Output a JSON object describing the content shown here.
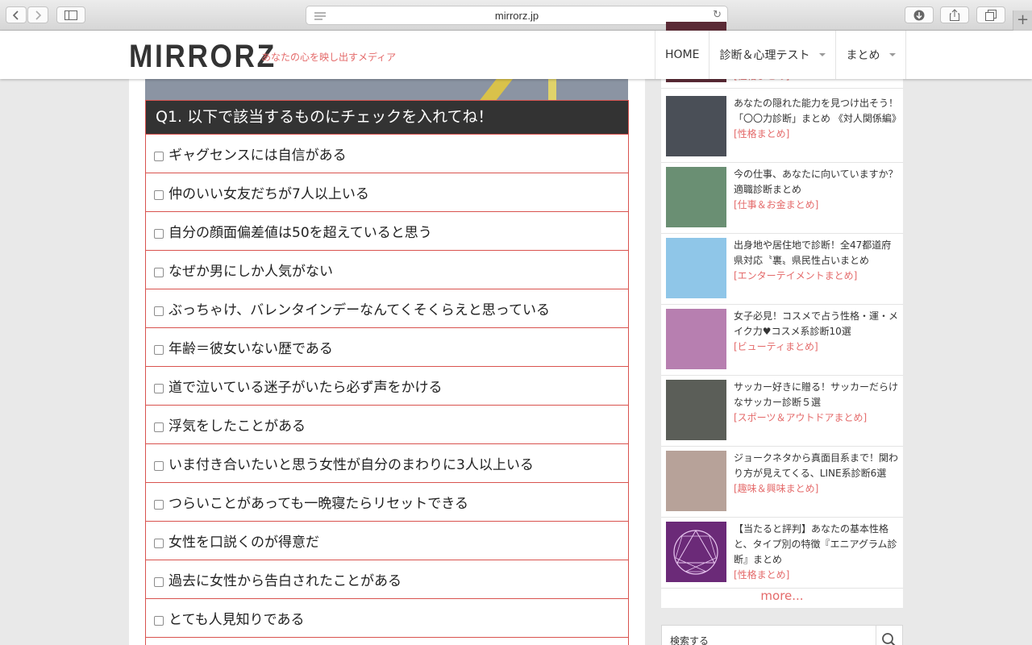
{
  "browser": {
    "url": "mirrorz.jp"
  },
  "site": {
    "logo": "MIRRORZ",
    "tagline": "あなたの心を映し出すメディア",
    "nav": [
      "HOME",
      "診断＆心理テスト",
      "まとめ"
    ]
  },
  "question": {
    "title": "Q1. 以下で該当するものにチェックを入れてね！",
    "items": [
      "ギャグセンスには自信がある",
      "仲のいい女友だちが7人以上いる",
      "自分の顔面偏差値は50を超えていると思う",
      "なぜか男にしか人気がない",
      "ぶっちゃけ、バレンタインデーなんてくそくらえと思っている",
      "年齢＝彼女いない歴である",
      "道で泣いている迷子がいたら必ず声をかける",
      "浮気をしたことがある",
      "いま付き合いたいと思う女性が自分のまわりに3人以上いる",
      "つらいことがあっても一晩寝たらリセットできる",
      "女性を口説くのが得意だ",
      "過去に女性から告白されたことがある",
      "とても人見知りである"
    ]
  },
  "sidebar": {
    "partial_category": "[性格まとめ]",
    "items": [
      {
        "title": "あなたの隠れた能力を見つけ出そう！「〇〇力診断」まとめ 《対人関係編》",
        "category": "[性格まとめ]",
        "color": "#4a4f57"
      },
      {
        "title": "今の仕事、あなたに向いていますか？適職診断まとめ",
        "category": "[仕事＆お金まとめ]",
        "color": "#6a8f73"
      },
      {
        "title": "出身地や居住地で診断！全47都道府県対応〝裏〟県民性占いまとめ",
        "category": "[エンターテイメントまとめ]",
        "color": "#8fc6e8"
      },
      {
        "title": "女子必見！コスメで占う性格・運・メイク力♥コスメ系診断10選",
        "category": "[ビューティまとめ]",
        "color": "#b77fb0"
      },
      {
        "title": "サッカー好きに贈る！サッカーだらけなサッカー診断５選",
        "category": "[スポーツ＆アウトドアまとめ]",
        "color": "#5b5e58"
      },
      {
        "title": "ジョークネタから真面目系まで！関わり方が見えてくる、LINE系診断6選",
        "category": "[趣味＆興味まとめ]",
        "color": "#b7a299"
      },
      {
        "title": "【当たると評判】あなたの基本性格と、タイプ別の特徴『エニアグラム診断』まとめ",
        "category": "[性格まとめ]",
        "color": "#6b2a78"
      }
    ],
    "more": "more...",
    "search_label": "検索する"
  }
}
